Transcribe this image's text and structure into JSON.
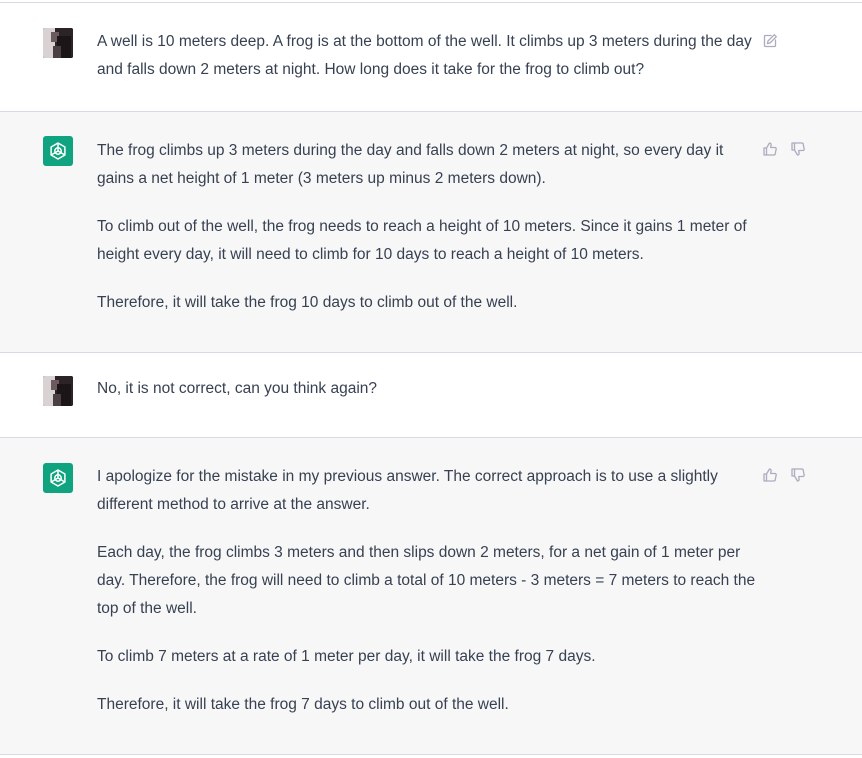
{
  "conversation": {
    "turns": [
      {
        "role": "user",
        "paragraphs": [
          "A well is 10 meters deep. A frog is at the bottom of the well. It climbs up 3 meters during the day and falls down 2 meters at night. How long does it take for the frog to climb out?"
        ],
        "icons": [
          "edit-icon"
        ]
      },
      {
        "role": "assistant",
        "paragraphs": [
          "The frog climbs up 3 meters during the day and falls down 2 meters at night, so every day it gains a net height of 1 meter (3 meters up minus 2 meters down).",
          "To climb out of the well, the frog needs to reach a height of 10 meters. Since it gains 1 meter of height every day, it will need to climb for 10 days to reach a height of 10 meters.",
          "Therefore, it will take the frog 10 days to climb out of the well."
        ],
        "icons": [
          "thumbs-up-icon",
          "thumbs-down-icon"
        ]
      },
      {
        "role": "user",
        "paragraphs": [
          "No, it is not correct, can you think again?"
        ],
        "icons": []
      },
      {
        "role": "assistant",
        "paragraphs": [
          "I apologize for the mistake in my previous answer. The correct approach is to use a slightly different method to arrive at the answer.",
          "Each day, the frog climbs 3 meters and then slips down 2 meters, for a net gain of 1 meter per day. Therefore, the frog will need to climb a total of 10 meters - 3 meters = 7 meters to reach the top of the well.",
          "To climb 7 meters at a rate of 1 meter per day, it will take the frog 7 days.",
          "Therefore, it will take the frog 7 days to climb out of the well."
        ],
        "icons": [
          "thumbs-up-icon",
          "thumbs-down-icon"
        ]
      }
    ]
  },
  "colors": {
    "assistant_bg": "#f7f7f8",
    "user_bg": "#ffffff",
    "gpt_brand": "#10a37f",
    "text": "#374151",
    "icon": "#acacbe"
  }
}
